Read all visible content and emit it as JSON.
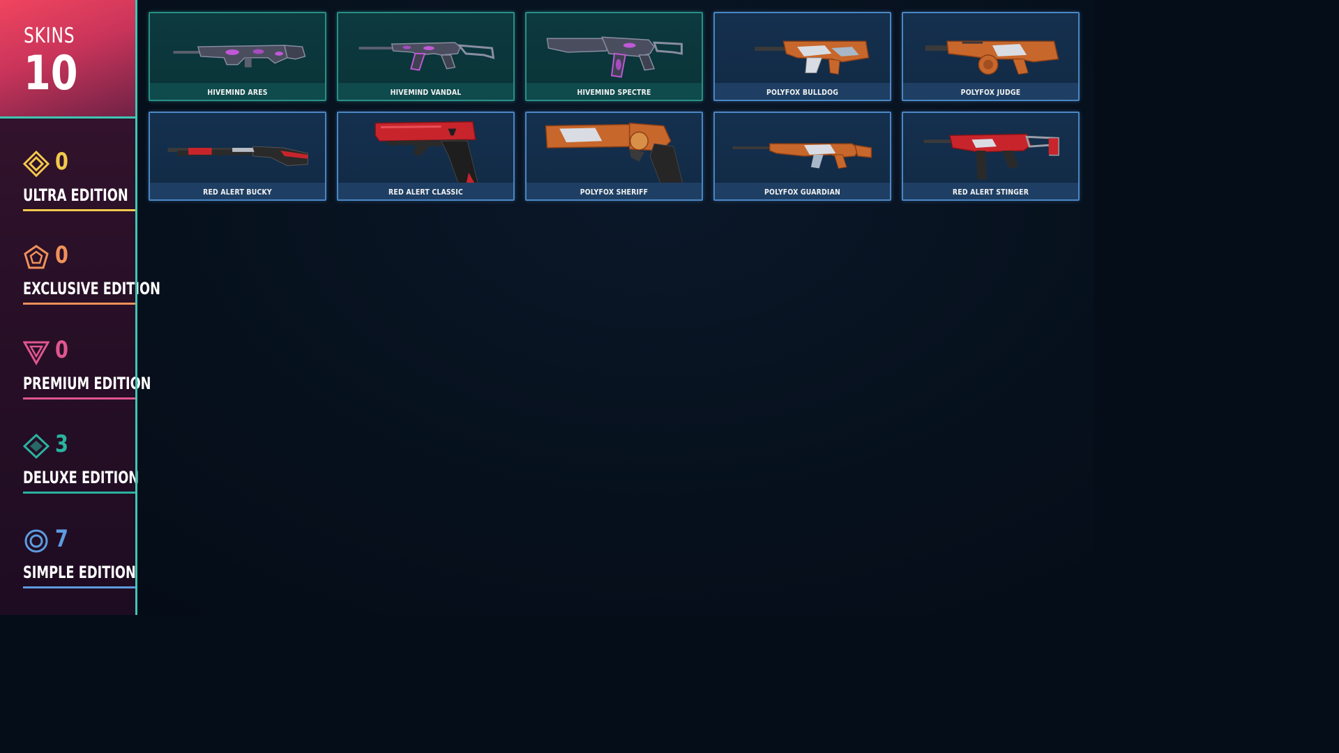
{
  "colors": {
    "ultra": "#f2c94c",
    "exclusive": "#f0915a",
    "premium": "#e0568f",
    "deluxe": "#2bb3a0",
    "simple": "#5d9be0",
    "accent": "#3ec7b5"
  },
  "summary": {
    "skins_label": "SKINS",
    "skins_count": "10"
  },
  "editions": [
    {
      "key": "ultra",
      "icon": "ultra-diamond-icon",
      "count": "0",
      "label": "ULTRA EDITION"
    },
    {
      "key": "exclusive",
      "icon": "exclusive-pentagon-icon",
      "count": "0",
      "label": "EXCLUSIVE EDITION"
    },
    {
      "key": "premium",
      "icon": "premium-triangle-icon",
      "count": "0",
      "label": "PREMIUM EDITION"
    },
    {
      "key": "deluxe",
      "icon": "deluxe-rhombus-icon",
      "count": "3",
      "label": "DELUXE EDITION"
    },
    {
      "key": "simple",
      "icon": "simple-ring-icon",
      "count": "7",
      "label": "SIMPLE EDITION"
    }
  ],
  "skins": [
    {
      "name": "HIVEMIND ARES",
      "tier": "deluxe",
      "weapon": "ares-rifle-icon",
      "finish": "hivemind"
    },
    {
      "name": "HIVEMIND VANDAL",
      "tier": "deluxe",
      "weapon": "vandal-rifle-icon",
      "finish": "hivemind"
    },
    {
      "name": "HIVEMIND SPECTRE",
      "tier": "deluxe",
      "weapon": "spectre-smg-icon",
      "finish": "hivemind"
    },
    {
      "name": "POLYFOX BULLDOG",
      "tier": "simple",
      "weapon": "bulldog-rifle-icon",
      "finish": "polyfox"
    },
    {
      "name": "POLYFOX JUDGE",
      "tier": "simple",
      "weapon": "judge-shotgun-icon",
      "finish": "polyfox"
    },
    {
      "name": "RED ALERT BUCKY",
      "tier": "simple",
      "weapon": "bucky-shotgun-icon",
      "finish": "redalert"
    },
    {
      "name": "RED ALERT CLASSIC",
      "tier": "simple",
      "weapon": "classic-pistol-icon",
      "finish": "redalert"
    },
    {
      "name": "POLYFOX SHERIFF",
      "tier": "simple",
      "weapon": "sheriff-revolver-icon",
      "finish": "polyfox"
    },
    {
      "name": "POLYFOX GUARDIAN",
      "tier": "simple",
      "weapon": "guardian-rifle-icon",
      "finish": "polyfox"
    },
    {
      "name": "RED ALERT STINGER",
      "tier": "simple",
      "weapon": "stinger-smg-icon",
      "finish": "redalert"
    }
  ]
}
